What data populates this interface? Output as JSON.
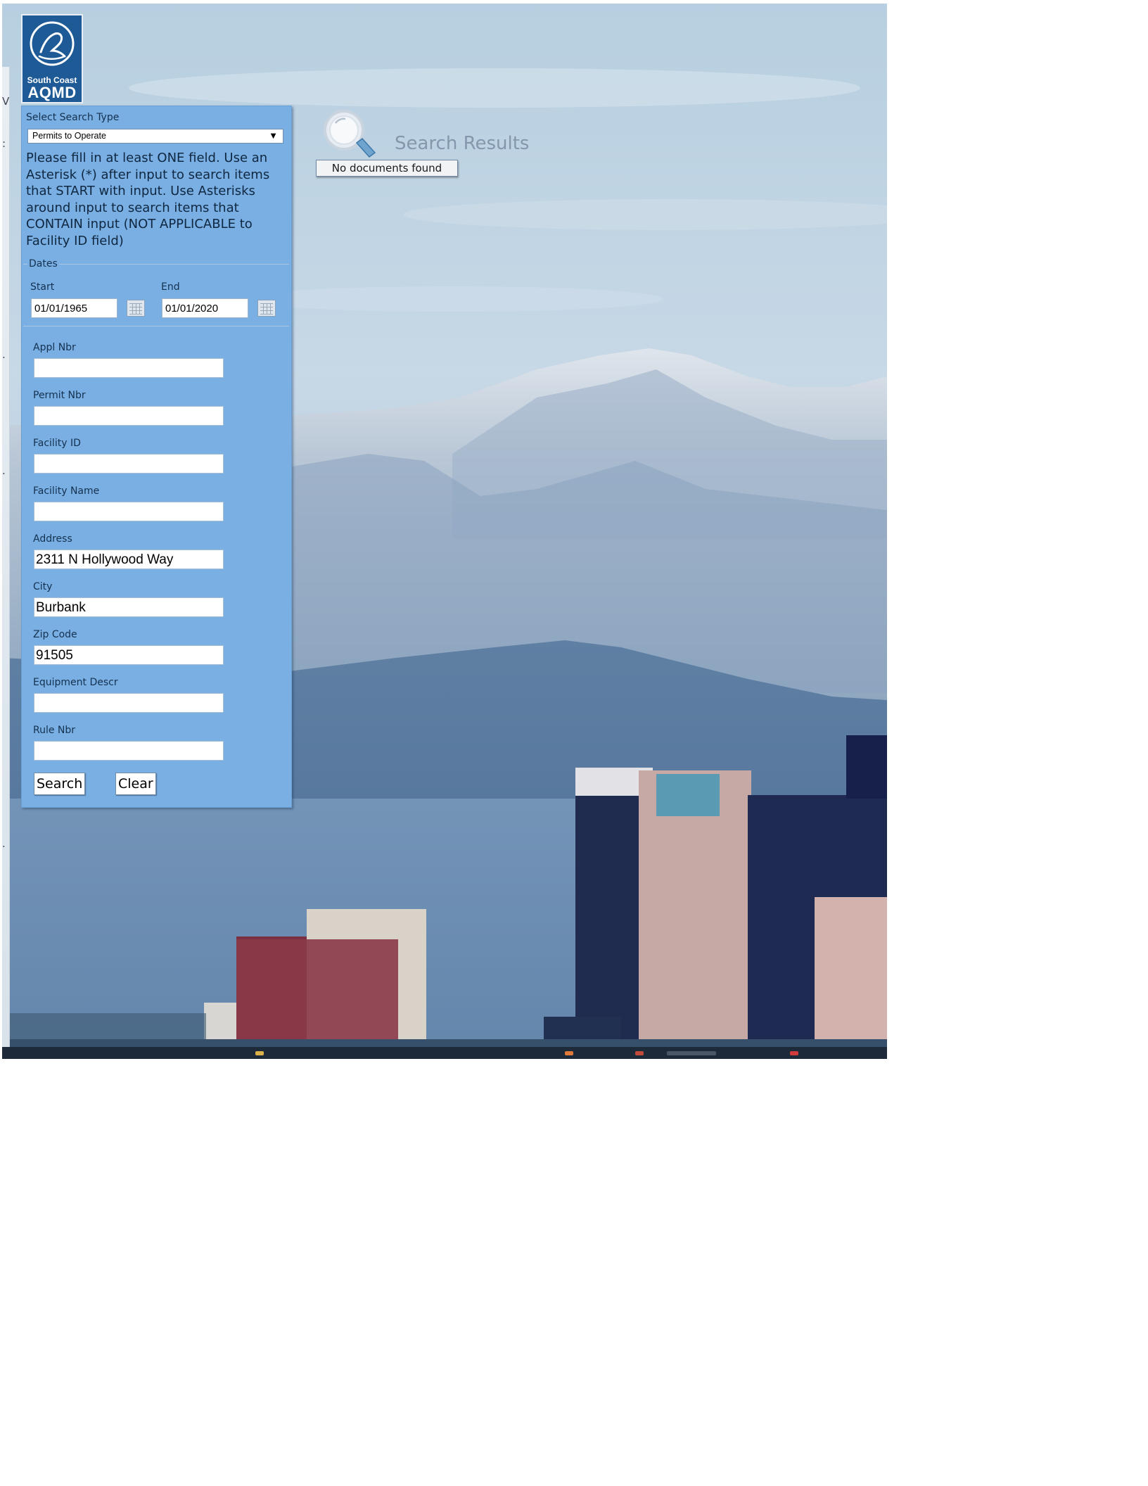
{
  "logo": {
    "subtitle": "South Coast",
    "title": "AQMD"
  },
  "search_type": {
    "label": "Select Search Type",
    "selected": "Permits to Operate"
  },
  "instructions": "Please fill in at least ONE field. Use an Asterisk (*) after input to search items that START with input. Use Asterisks around input to search items that CONTAIN input (NOT APPLICABLE to Facility ID field)",
  "dates": {
    "legend": "Dates",
    "start_label": "Start",
    "start_value": "01/01/1965",
    "end_label": "End",
    "end_value": "01/01/2020"
  },
  "fields": [
    {
      "label": "Appl Nbr",
      "value": ""
    },
    {
      "label": "Permit Nbr",
      "value": ""
    },
    {
      "label": "Facility ID",
      "value": ""
    },
    {
      "label": "Facility Name",
      "value": ""
    },
    {
      "label": "Address",
      "value": "2311 N Hollywood Way"
    },
    {
      "label": "City",
      "value": "Burbank"
    },
    {
      "label": "Zip Code",
      "value": "91505"
    },
    {
      "label": "Equipment Descr",
      "value": ""
    },
    {
      "label": "Rule Nbr",
      "value": ""
    }
  ],
  "buttons": {
    "search": "Search",
    "clear": "Clear"
  },
  "results": {
    "title": "Search Results",
    "status": "No documents found"
  },
  "colors": {
    "panel": "#7aafe3",
    "logo": "#1e5a96",
    "sky": "#c4d6e6",
    "mountain": "#6f8aa6"
  }
}
